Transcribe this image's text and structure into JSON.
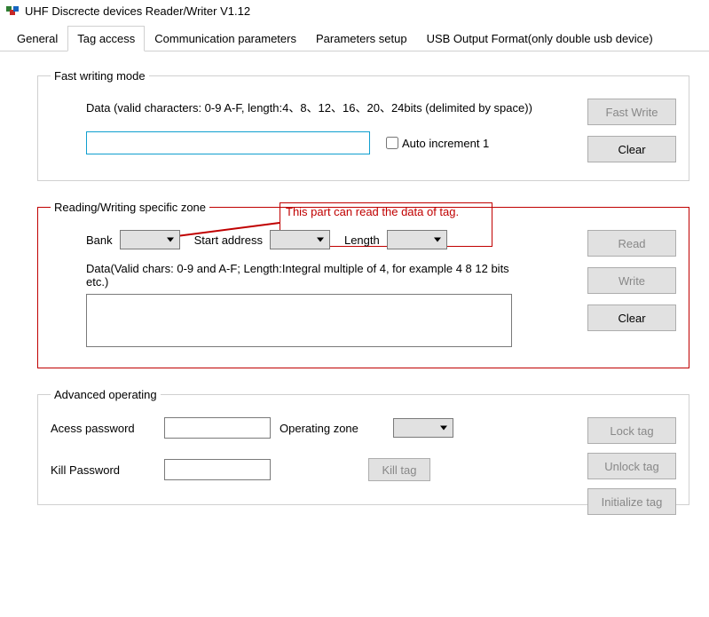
{
  "app": {
    "title": "UHF Discrecte devices Reader/Writer V1.12"
  },
  "tabs": {
    "general": "General",
    "tag_access": "Tag access",
    "comm_params": "Communication parameters",
    "params_setup": "Parameters setup",
    "usb_output": "USB Output Format(only double usb device)"
  },
  "fast_writing": {
    "legend": "Fast writing mode",
    "data_label": "Data (valid characters: 0-9 A-F, length:4、8、12、16、20、24bits (delimited by space))",
    "input_value": "",
    "auto_increment_label": "Auto increment 1",
    "auto_increment_checked": false,
    "fast_write_btn": "Fast Write",
    "clear_btn": "Clear"
  },
  "annotation": {
    "text": "This part can read the data of tag."
  },
  "rw_zone": {
    "legend": "Reading/Writing specific zone",
    "bank_label": "Bank",
    "bank_value": "",
    "start_addr_label": "Start address",
    "start_addr_value": "",
    "length_label": "Length",
    "length_value": "",
    "data_hint": "Data(Valid chars: 0-9 and A-F; Length:Integral multiple of 4, for example 4 8 12 bits etc.)",
    "textarea_value": "",
    "read_btn": "Read",
    "write_btn": "Write",
    "clear_btn": "Clear"
  },
  "advanced": {
    "legend": "Advanced operating",
    "access_pw_label": "Acess password",
    "access_pw_value": "",
    "operating_zone_label": "Operating zone",
    "operating_zone_value": "",
    "kill_pw_label": "Kill Password",
    "kill_pw_value": "",
    "kill_tag_btn": "Kill tag",
    "lock_tag_btn": "Lock tag",
    "unlock_tag_btn": "Unlock tag",
    "initialize_tag_btn": "Initialize tag"
  }
}
